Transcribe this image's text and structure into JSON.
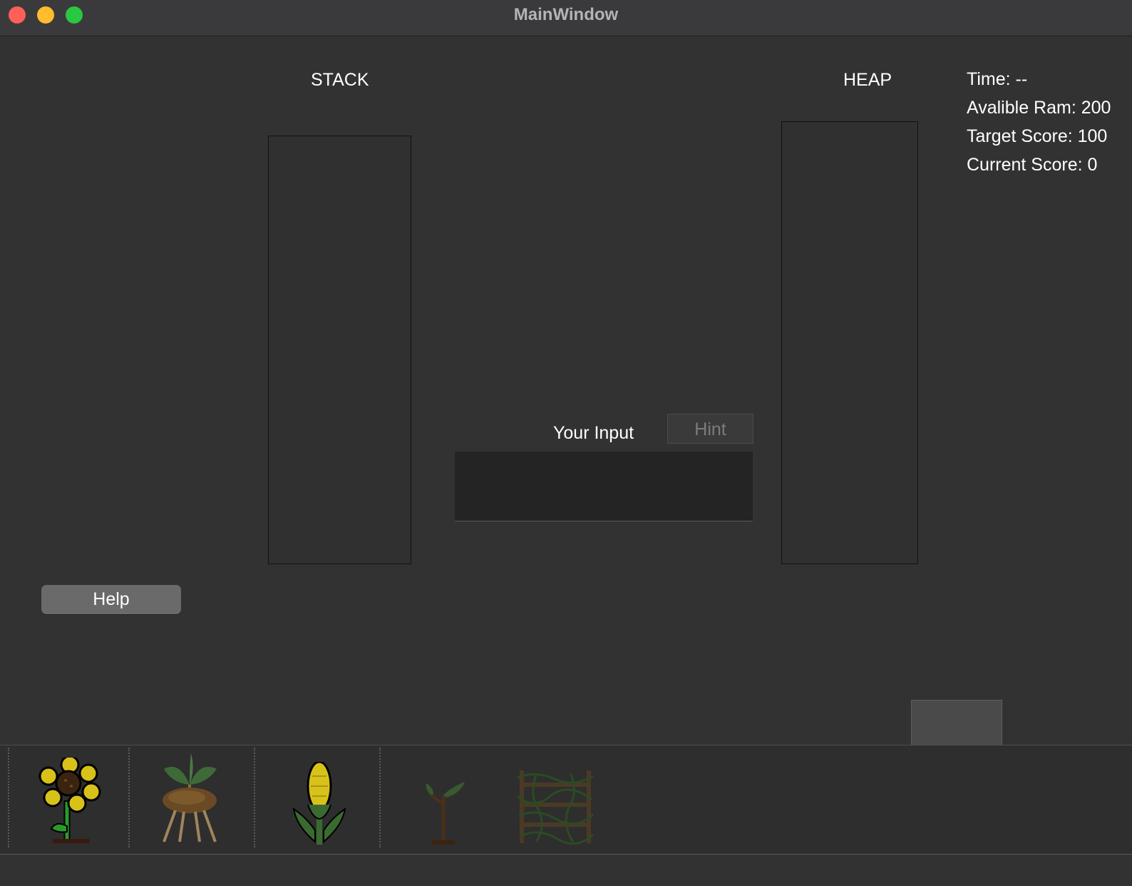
{
  "window": {
    "title": "MainWindow"
  },
  "labels": {
    "stack": "STACK",
    "heap": "HEAP",
    "your_input": "Your Input"
  },
  "stats": {
    "time": "Time: --",
    "ram": "Avalible Ram: 200",
    "target": "Target Score: 100",
    "current": "Current Score: 0"
  },
  "buttons": {
    "hint": "Hint",
    "help": "Help"
  },
  "input": {
    "value": ""
  },
  "toolbar": {
    "items": [
      "sunflower-icon",
      "potato-icon",
      "corn-icon",
      "sapling-icon",
      "vine-fence-icon"
    ]
  },
  "colors": {
    "background": "#323232",
    "titlebar": "#3a3a3c",
    "close": "#fe5f57",
    "minimize": "#febc2e",
    "maximize": "#28c840"
  }
}
